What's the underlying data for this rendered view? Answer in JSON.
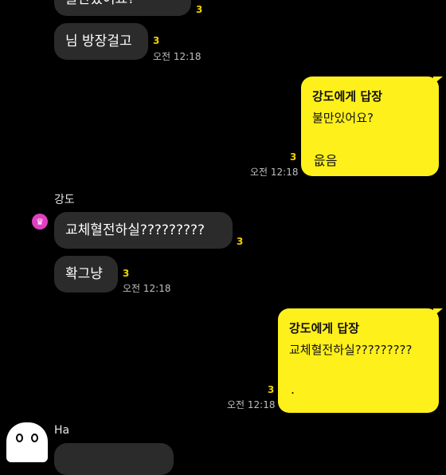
{
  "messages": [
    {
      "id": "m0",
      "text": "불만있어요?",
      "unread": "3"
    },
    {
      "id": "m1",
      "text": "님 방장걸고",
      "unread": "3",
      "time": "오전 12:18"
    },
    {
      "id": "m2",
      "reply_to": "강도에게 답장",
      "quote": "불만있어요?",
      "text": "읎음",
      "unread": "3",
      "time": "오전 12:18"
    },
    {
      "id": "m3",
      "sender": "강도",
      "text": "교체혈전하실?????????",
      "unread": "3"
    },
    {
      "id": "m4",
      "text": "확그냥",
      "unread": "3",
      "time": "오전 12:18"
    },
    {
      "id": "m5",
      "reply_to": "강도에게 답장",
      "quote": "교체혈전하실?????????",
      "text": ".",
      "unread": "3",
      "time": "오전 12:18"
    },
    {
      "id": "m6",
      "sender": "Ha"
    }
  ]
}
